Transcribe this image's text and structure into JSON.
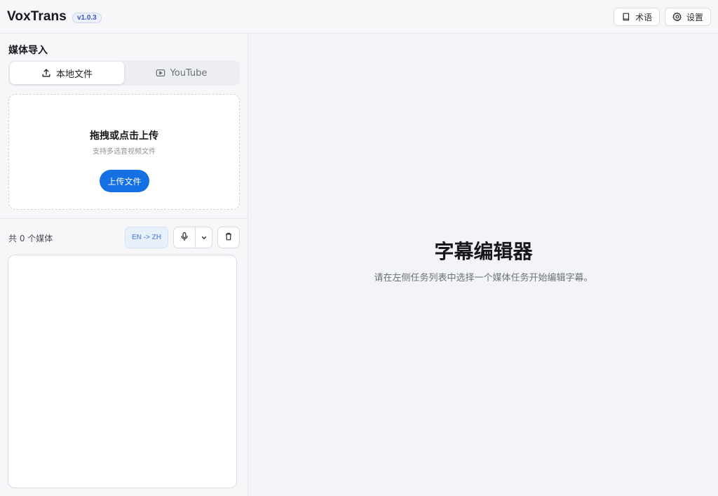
{
  "header": {
    "app_name": "VoxTrans",
    "version": "v1.0.3",
    "terms_label": "术语",
    "terms_icon": "book-icon",
    "settings_label": "设置",
    "settings_icon": "gear-icon"
  },
  "sidebar": {
    "section_title": "媒体导入",
    "tabs": [
      {
        "label": "本地文件",
        "icon": "upload-icon",
        "active": true
      },
      {
        "label": "YouTube",
        "icon": "youtube-play-icon",
        "active": false
      }
    ],
    "dropzone": {
      "title": "拖拽或点击上传",
      "subtitle": "支持多选音视频文件",
      "button_label": "上传文件"
    },
    "media_count_label": "共 0 个媒体",
    "language_pair": "EN -> ZH",
    "mic_icon": "microphone-icon",
    "dropdown_icon": "chevron-down-icon",
    "delete_icon": "trash-icon"
  },
  "main": {
    "title": "字幕编辑器",
    "subtitle": "请在左侧任务列表中选择一个媒体任务开始编辑字幕。"
  },
  "colors": {
    "primary": "#1570e3",
    "version_badge": "#3b57c9",
    "lang_badge_text": "#6d9ae0"
  }
}
